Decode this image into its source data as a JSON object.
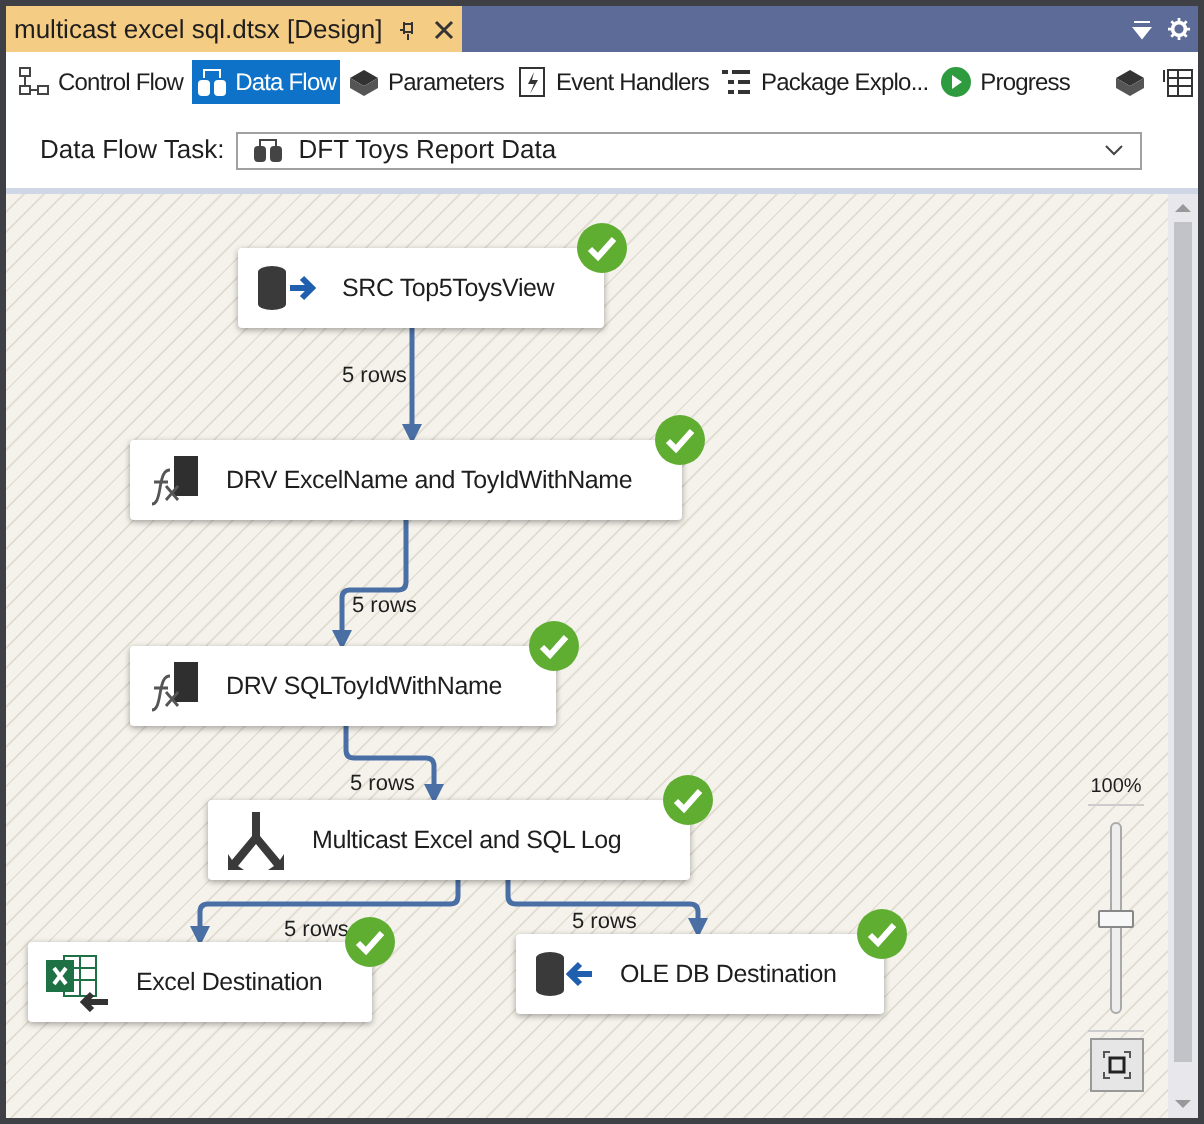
{
  "document_tab": {
    "title": "multicast excel sql.dtsx [Design]",
    "selected": true
  },
  "toolbar": [
    {
      "label": "Control Flow",
      "selected": false
    },
    {
      "label": "Data Flow",
      "selected": true
    },
    {
      "label": "Parameters",
      "selected": false
    },
    {
      "label": "Event Handlers",
      "selected": false
    },
    {
      "label": "Package Explo...",
      "selected": false
    },
    {
      "label": "Progress",
      "selected": false
    }
  ],
  "task_selector": {
    "label": "Data Flow Task:",
    "value": "DFT Toys Report Data"
  },
  "nodes": [
    {
      "label": "SRC Top5ToysView",
      "kind": "source",
      "completed": true
    },
    {
      "label": "DRV ExcelName and ToyIdWithName",
      "kind": "derived",
      "completed": true
    },
    {
      "label": "DRV SQLToyIdWithName",
      "kind": "derived",
      "completed": true
    },
    {
      "label": "Multicast Excel and SQL Log",
      "kind": "multicast",
      "completed": true
    },
    {
      "label": "Excel Destination",
      "kind": "excel",
      "completed": true
    },
    {
      "label": "OLE DB Destination",
      "kind": "oledb",
      "completed": true
    }
  ],
  "paths": [
    {
      "label": "5 rows"
    },
    {
      "label": "5 rows"
    },
    {
      "label": "5 rows"
    },
    {
      "label": "5 rows"
    },
    {
      "label": "5 rows"
    }
  ],
  "zoom": {
    "label": "100%",
    "level": 0.5
  }
}
